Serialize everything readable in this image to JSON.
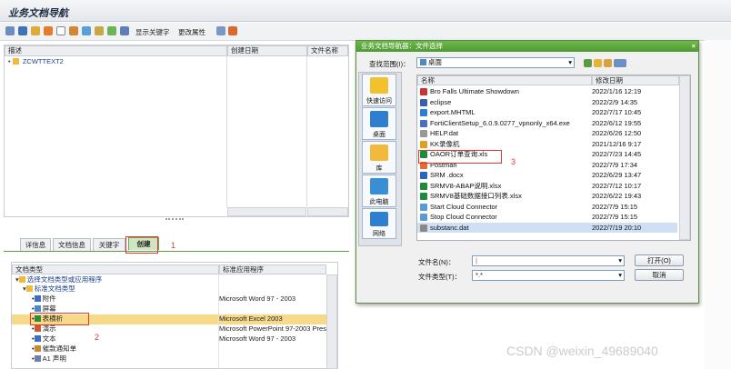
{
  "title": "业务文档导航",
  "toolbar": {
    "keyword_label": "显示关键字",
    "props_label": "更改属性"
  },
  "tree_panel": {
    "headers": [
      "描述",
      "创建日期",
      "文件名称"
    ],
    "items": [
      "ZCWTTEXT2"
    ]
  },
  "tabs": [
    "详信息",
    "文档信息",
    "关键字",
    "创建"
  ],
  "doc_panel": {
    "headers": [
      "文档类型",
      "标准应用程序"
    ],
    "rows": [
      {
        "label": "选择文档类型或应用程序",
        "app": ""
      },
      {
        "label": "标准文档类型",
        "app": ""
      },
      {
        "label": "附件",
        "app": "Microsoft Word 97 - 2003"
      },
      {
        "label": "屏幕",
        "app": ""
      },
      {
        "label": "表横析",
        "app": "Microsoft Excel 2003"
      },
      {
        "label": "演示",
        "app": "Microsoft PowerPoint 97-2003 Prese"
      },
      {
        "label": "文本",
        "app": "Microsoft Word 97 - 2003"
      },
      {
        "label": "催款通知单",
        "app": ""
      },
      {
        "label": "A1 声明",
        "app": ""
      }
    ]
  },
  "dialog": {
    "title": "业务文档导航器：文件选择",
    "look_in_label": "查找范围(I)：",
    "look_in_value": "桌面",
    "places": [
      "快速访问",
      "桌面",
      "库",
      "此电脑",
      "网络"
    ],
    "col_name": "名称",
    "col_date": "修改日期",
    "files": [
      {
        "name": "Bro Falls Ultimate Showdown",
        "date": "2022/1/16 12:19"
      },
      {
        "name": "eclipse",
        "date": "2022/2/9 14:35"
      },
      {
        "name": "export.MHTML",
        "date": "2022/7/17 10:45"
      },
      {
        "name": "FortiClientSetup_6.0.9.0277_vpnonly_x64.exe",
        "date": "2022/6/12 19:55"
      },
      {
        "name": "HELP.dat",
        "date": "2022/6/26 12:50"
      },
      {
        "name": "KK录像机",
        "date": "2021/12/16 9:17"
      },
      {
        "name": "OAOR订单查询.xls",
        "date": "2022/7/23 14:45"
      },
      {
        "name": "Postman",
        "date": "2022/7/9 17:34"
      },
      {
        "name": "SRM .docx",
        "date": "2022/6/29 13:47"
      },
      {
        "name": "SRMV8-ABAP说明.xlsx",
        "date": "2022/7/12 10:17"
      },
      {
        "name": "SRMV8基础数据接口列表.xlsx",
        "date": "2022/6/22 19:43"
      },
      {
        "name": "Start Cloud Connector",
        "date": "2022/7/9 15:15"
      },
      {
        "name": "Stop Cloud Connector",
        "date": "2022/7/9 15:15"
      },
      {
        "name": "substanc.dat",
        "date": "2022/7/19 20:10"
      }
    ],
    "filename_label": "文件名(N)：",
    "filetype_label": "文件类型(T)：",
    "filetype_value": "*.*",
    "open_label": "打开(O)",
    "cancel_label": "取消"
  },
  "annotations": [
    "1",
    "2",
    "3"
  ],
  "watermark": "CSDN @weixin_49689040",
  "colors": {
    "accent_green": "#4e9a33",
    "annotation_red": "#e0392f",
    "folder": "#f3b93c"
  }
}
